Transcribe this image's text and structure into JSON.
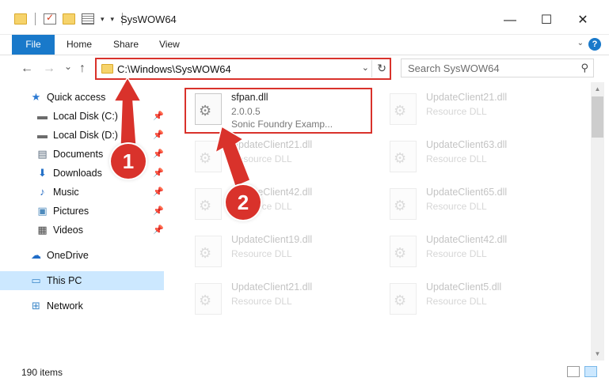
{
  "window": {
    "title": "SysWOW64",
    "minimize": "—",
    "maximize": "☐",
    "close": "✕"
  },
  "ribbon": {
    "file": "File",
    "tabs": [
      "Home",
      "Share",
      "View"
    ],
    "help": "?"
  },
  "nav": {
    "back": "←",
    "forward": "→",
    "recent": "⌄",
    "up": "↑"
  },
  "address": {
    "path": "C:\\Windows\\SysWOW64",
    "dropdown": "⌄",
    "refresh": "↻"
  },
  "search": {
    "placeholder": "Search SysWOW64",
    "icon": "⚲"
  },
  "sidebar": {
    "items": [
      {
        "label": "Quick access",
        "icon": "star-icon",
        "glyph": "★",
        "color": "#2b79d2",
        "pinned": false
      },
      {
        "label": "Local Disk (C:)",
        "icon": "drive-icon",
        "glyph": "▬",
        "color": "#6b6b6b",
        "pinned": true
      },
      {
        "label": "Local Disk (D:)",
        "icon": "drive-icon",
        "glyph": "▬",
        "color": "#6b6b6b",
        "pinned": true
      },
      {
        "label": "Documents",
        "icon": "documents-icon",
        "glyph": "▤",
        "color": "#5b6c7e",
        "pinned": true
      },
      {
        "label": "Downloads",
        "icon": "download-icon",
        "glyph": "⬇",
        "color": "#2672c8",
        "pinned": true
      },
      {
        "label": "Music",
        "icon": "music-icon",
        "glyph": "♪",
        "color": "#2b6fc4",
        "pinned": true
      },
      {
        "label": "Pictures",
        "icon": "pictures-icon",
        "glyph": "▣",
        "color": "#4f8bbd",
        "pinned": true
      },
      {
        "label": "Videos",
        "icon": "videos-icon",
        "glyph": "▦",
        "color": "#444",
        "pinned": true
      },
      {
        "label": "OneDrive",
        "icon": "cloud-icon",
        "glyph": "☁",
        "color": "#1f6cc7",
        "pinned": false
      },
      {
        "label": "This PC",
        "icon": "computer-icon",
        "glyph": "▭",
        "color": "#3a86c8",
        "pinned": false
      },
      {
        "label": "Network",
        "icon": "network-icon",
        "glyph": "⊞",
        "color": "#3a86c8",
        "pinned": false
      }
    ],
    "pin_glyph": "📌"
  },
  "files": [
    {
      "name": "sfpan.dll",
      "line1": "2.0.0.5",
      "line2": "Sonic Foundry Examp...",
      "faded": false
    },
    {
      "name": "UpdateClient21.dll",
      "line1": "Resource DLL",
      "faded": true
    },
    {
      "name": "UpdateClient21.dll",
      "line1": "Resource DLL",
      "faded": true
    },
    {
      "name": "UpdateClient63.dll",
      "line1": "Resource DLL",
      "faded": true
    },
    {
      "name": "UpdateClient42.dll",
      "line1": "Resource DLL",
      "faded": true
    },
    {
      "name": "UpdateClient65.dll",
      "line1": "Resource DLL",
      "faded": true
    },
    {
      "name": "UpdateClient19.dll",
      "line1": "Resource DLL",
      "faded": true
    },
    {
      "name": "UpdateClient42.dll",
      "line1": "Resource DLL",
      "faded": true
    },
    {
      "name": "UpdateClient21.dll",
      "line1": "Resource DLL",
      "faded": true
    },
    {
      "name": "UpdateClient5.dll",
      "line1": "Resource DLL",
      "faded": true
    }
  ],
  "status": {
    "count": "190 items"
  },
  "callouts": {
    "one": "1",
    "two": "2"
  },
  "colors": {
    "accent": "#1979ca",
    "annotation_red": "#d9322b",
    "selected_bg": "#cce8ff"
  }
}
